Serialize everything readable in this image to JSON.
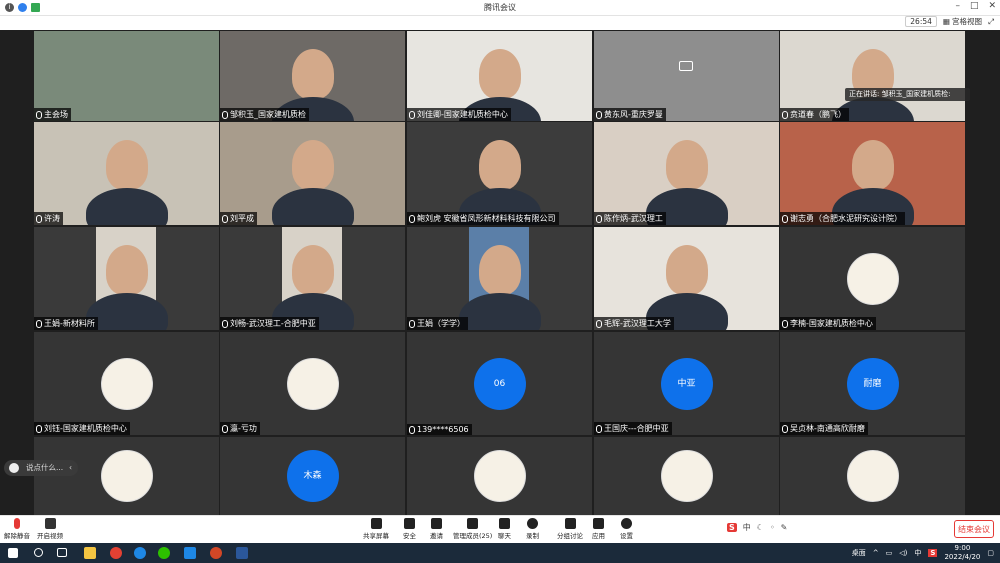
{
  "window": {
    "title": "腾讯会议"
  },
  "header": {
    "timer": "26:54",
    "view_label": "宫格视图"
  },
  "speaking": "正在讲话: 邹积玉_国家建机质检:",
  "tiles": [
    {
      "name": "主会场",
      "kind": "video"
    },
    {
      "name": "邹积玉_国家建机质检",
      "kind": "video"
    },
    {
      "name": "刘佳卿-国家建机质检中心",
      "kind": "video"
    },
    {
      "name": "黄东风-重庆罗曼",
      "kind": "camoff"
    },
    {
      "name": "贲道春（鹏飞）",
      "kind": "video"
    },
    {
      "name": "许涛",
      "kind": "video"
    },
    {
      "name": "刘平成",
      "kind": "video"
    },
    {
      "name": "鲍刘虎 安徽省凤形新材料科技有限公司",
      "kind": "video"
    },
    {
      "name": "陈作炳-武汉理工",
      "kind": "video"
    },
    {
      "name": "谢志勇（合肥水泥研究设计院）",
      "kind": "video"
    },
    {
      "name": "王娟-新材料所",
      "kind": "video"
    },
    {
      "name": "刘畅-武汉理工-合肥中亚",
      "kind": "video"
    },
    {
      "name": "王娟（学学）",
      "kind": "video"
    },
    {
      "name": "毛辉-武汉理工大学",
      "kind": "video"
    },
    {
      "name": "李楠-国家建机质检中心",
      "kind": "avatar-pic"
    },
    {
      "name": "刘钰-国家建机质检中心",
      "kind": "avatar-pic"
    },
    {
      "name": "瀛-亏功",
      "kind": "avatar-pic"
    },
    {
      "name": "139****6506",
      "kind": "avatar",
      "avatar_text": "06"
    },
    {
      "name": "王国庆---合肥中亚",
      "kind": "avatar",
      "avatar_text": "中亚"
    },
    {
      "name": "吴贞林-南通高欣耐磨",
      "kind": "avatar",
      "avatar_text": "耐磨"
    },
    {
      "name": "",
      "kind": "avatar-pic"
    },
    {
      "name": "",
      "kind": "avatar",
      "avatar_text": "木森"
    },
    {
      "name": "",
      "kind": "avatar-pic"
    },
    {
      "name": "",
      "kind": "avatar-pic"
    },
    {
      "name": "",
      "kind": "avatar-pic"
    }
  ],
  "chat": {
    "placeholder": "说点什么..."
  },
  "toolbar": {
    "unmute": "解除静音",
    "start_video": "开启视频",
    "share": "共享屏幕",
    "security": "安全",
    "invite": "邀请",
    "members": "管理成员(25)",
    "chat": "聊天",
    "record": "录制",
    "breakout": "分组讨论",
    "apps": "应用",
    "settings": "设置",
    "end": "结束会议"
  },
  "ime": {
    "logo": "S",
    "lang": "中"
  },
  "taskbar": {
    "desktop": "桌面",
    "ime": "中",
    "time": "9:00",
    "date": "2022/4/20"
  },
  "colors": {
    "accent": "#0e71eb",
    "end": "#e53935"
  }
}
